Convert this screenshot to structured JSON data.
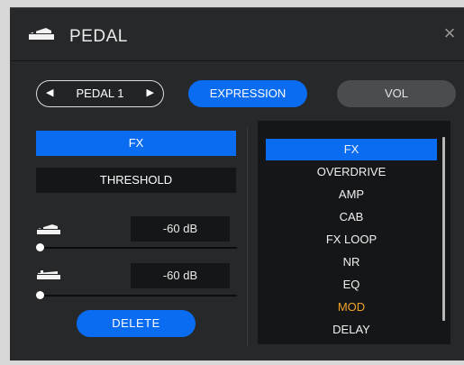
{
  "window": {
    "title": "PEDAL",
    "close_symbol": "×",
    "icon": "pedal-icon"
  },
  "top_controls": {
    "pedal_selector": {
      "left_arrow": "◀",
      "label": "PEDAL 1",
      "right_arrow": "▶"
    },
    "expression_label": "EXPRESSION",
    "vol_label": "VOL"
  },
  "left_panel": {
    "fx_label": "FX",
    "parameter_label": "THRESHOLD",
    "heel": {
      "icon": "pedal-heel-icon",
      "value": "-60 dB",
      "slider_value": 0
    },
    "toe": {
      "icon": "pedal-toe-icon",
      "value": "-60 dB",
      "slider_value": 0
    },
    "delete_label": "DELETE"
  },
  "fx_list": {
    "items": [
      "FX",
      "OVERDRIVE",
      "AMP",
      "CAB",
      "FX LOOP",
      "NR",
      "EQ",
      "MOD",
      "DELAY"
    ],
    "selected": "FX",
    "highlight": "MOD"
  },
  "colors": {
    "accent": "#0a6cf0",
    "background": "#27282a",
    "highlight_text": "#f0a22a"
  }
}
